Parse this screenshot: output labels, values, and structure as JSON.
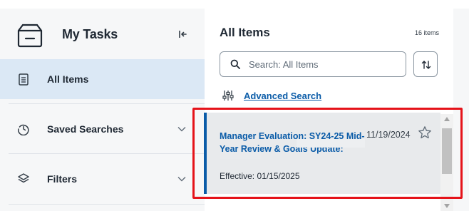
{
  "sidebar": {
    "title": "My Tasks",
    "header_icon": "inbox-tray-icon",
    "collapse_icon": "collapse-left-icon",
    "items": [
      {
        "label": "All Items",
        "icon": "clipboard-icon",
        "selected": true
      },
      {
        "label": "Saved Searches",
        "icon": "clock-history-icon",
        "expandable": true
      },
      {
        "label": "Filters",
        "icon": "layers-icon",
        "expandable": true
      }
    ]
  },
  "list": {
    "title": "All Items",
    "count": "16 items",
    "search_placeholder": "Search: All Items",
    "sort_icon": "sort-arrows-icon",
    "advanced_search_label": "Advanced Search",
    "advanced_search_icon": "sliders-icon"
  },
  "task_card": {
    "title": "Manager Evaluation: SY24-25 Mid-Year Review & Goals Update:",
    "date": "11/19/2024",
    "effective": "Effective: 01/15/2025",
    "star_icon": "star-outline-icon",
    "accent_color": "#0b5ca8"
  },
  "colors": {
    "selected_nav": "#dbe8f5",
    "link": "#0b5ca8",
    "highlight": "#e5131a"
  }
}
